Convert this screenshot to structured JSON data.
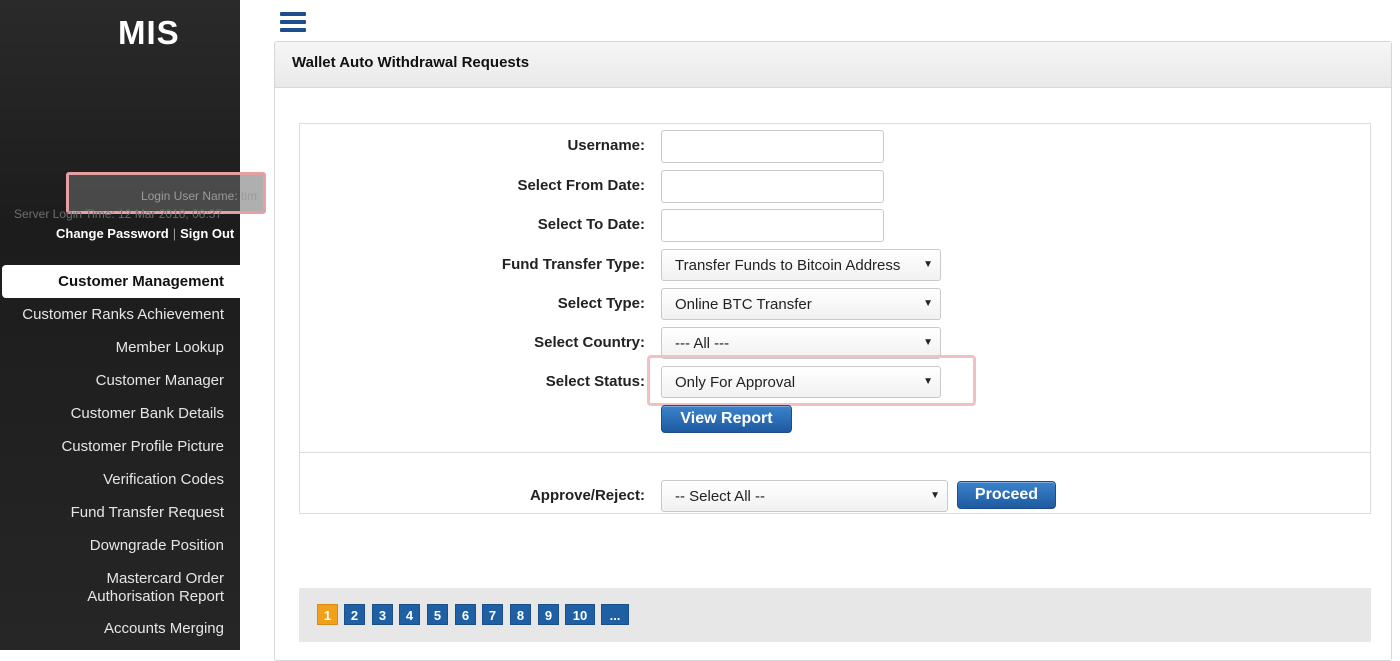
{
  "app": {
    "logo": "MIS"
  },
  "user": {
    "login_name": "Login User Name: tim",
    "server_time": "Server Login Time: 12 Mar 2018, 08:37",
    "change_password": "Change Password",
    "separator": "|",
    "sign_out": "Sign Out"
  },
  "sidebar": {
    "section": "Customer Management",
    "items": [
      "Customer Ranks Achievement",
      "Member Lookup",
      "Customer Manager",
      "Customer Bank Details",
      "Customer Profile Picture",
      "Verification Codes",
      "Fund Transfer Request",
      "Downgrade Position",
      "Mastercard Order",
      "Authorisation Report",
      "Accounts Merging"
    ]
  },
  "panel": {
    "title": "Wallet Auto Withdrawal Requests"
  },
  "form": {
    "username_label": "Username:",
    "from_date_label": "Select From Date:",
    "to_date_label": "Select To Date:",
    "fund_type_label": "Fund Transfer Type:",
    "fund_type_value": "Transfer Funds to Bitcoin Address",
    "type_label": "Select Type:",
    "type_value": "Online BTC Transfer",
    "country_label": "Select Country:",
    "country_value": "--- All ---",
    "status_label": "Select Status:",
    "status_value": "Only For Approval",
    "view_report": "View Report",
    "approve_label": "Approve/Reject:",
    "approve_value": "-- Select All --",
    "proceed": "Proceed"
  },
  "pager": {
    "pages": [
      "1",
      "2",
      "3",
      "4",
      "5",
      "6",
      "7",
      "8",
      "9",
      "10",
      "..."
    ],
    "current": "1"
  },
  "colors": {
    "accent": "#1f5fa4",
    "active_page": "#f0a01a",
    "highlight": "#efc1c4"
  }
}
